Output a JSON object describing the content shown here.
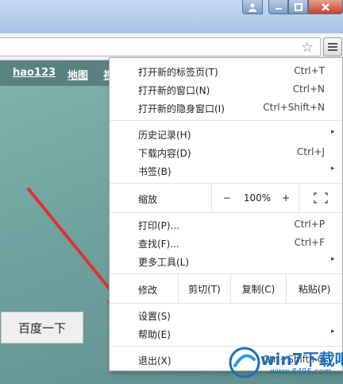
{
  "menu": {
    "items": [
      {
        "label": "打开新的标签页(T)",
        "shortcut": "Ctrl+T"
      },
      {
        "label": "打开新的窗口(N)",
        "shortcut": "Ctrl+N"
      },
      {
        "label": "打开新的隐身窗口(I)",
        "shortcut": "Ctrl+Shift+N"
      },
      {
        "label": "历史记录(H)",
        "submenu": "▸"
      },
      {
        "label": "下载内容(D)",
        "shortcut": "Ctrl+J"
      },
      {
        "label": "书签(B)",
        "submenu": "▸"
      },
      {
        "label": "打印(P)...",
        "shortcut": "Ctrl+P"
      },
      {
        "label": "查找(F)...",
        "shortcut": "Ctrl+F"
      },
      {
        "label": "更多工具(L)",
        "submenu": "▸"
      },
      {
        "label": "设置(S)"
      },
      {
        "label": "帮助(E)",
        "submenu": "▸"
      },
      {
        "label": "退出(X)",
        "shortcut": "Ctrl+Shift+Q"
      }
    ],
    "zoom": {
      "label": "缩放",
      "minus": "−",
      "value": "100%",
      "plus": "+"
    },
    "edit": {
      "label": "修改",
      "cut": "剪切(T)",
      "copy": "复制(C)",
      "paste": "粘贴(P)"
    }
  },
  "page": {
    "links": [
      "hao123",
      "地图",
      "视"
    ],
    "search_button": "百度一下"
  },
  "watermark": {
    "text": "win7下载吧",
    "url": "www.8495.com"
  },
  "colors": {
    "arrow": "#e03030",
    "page_bg": "#72a6a1"
  }
}
